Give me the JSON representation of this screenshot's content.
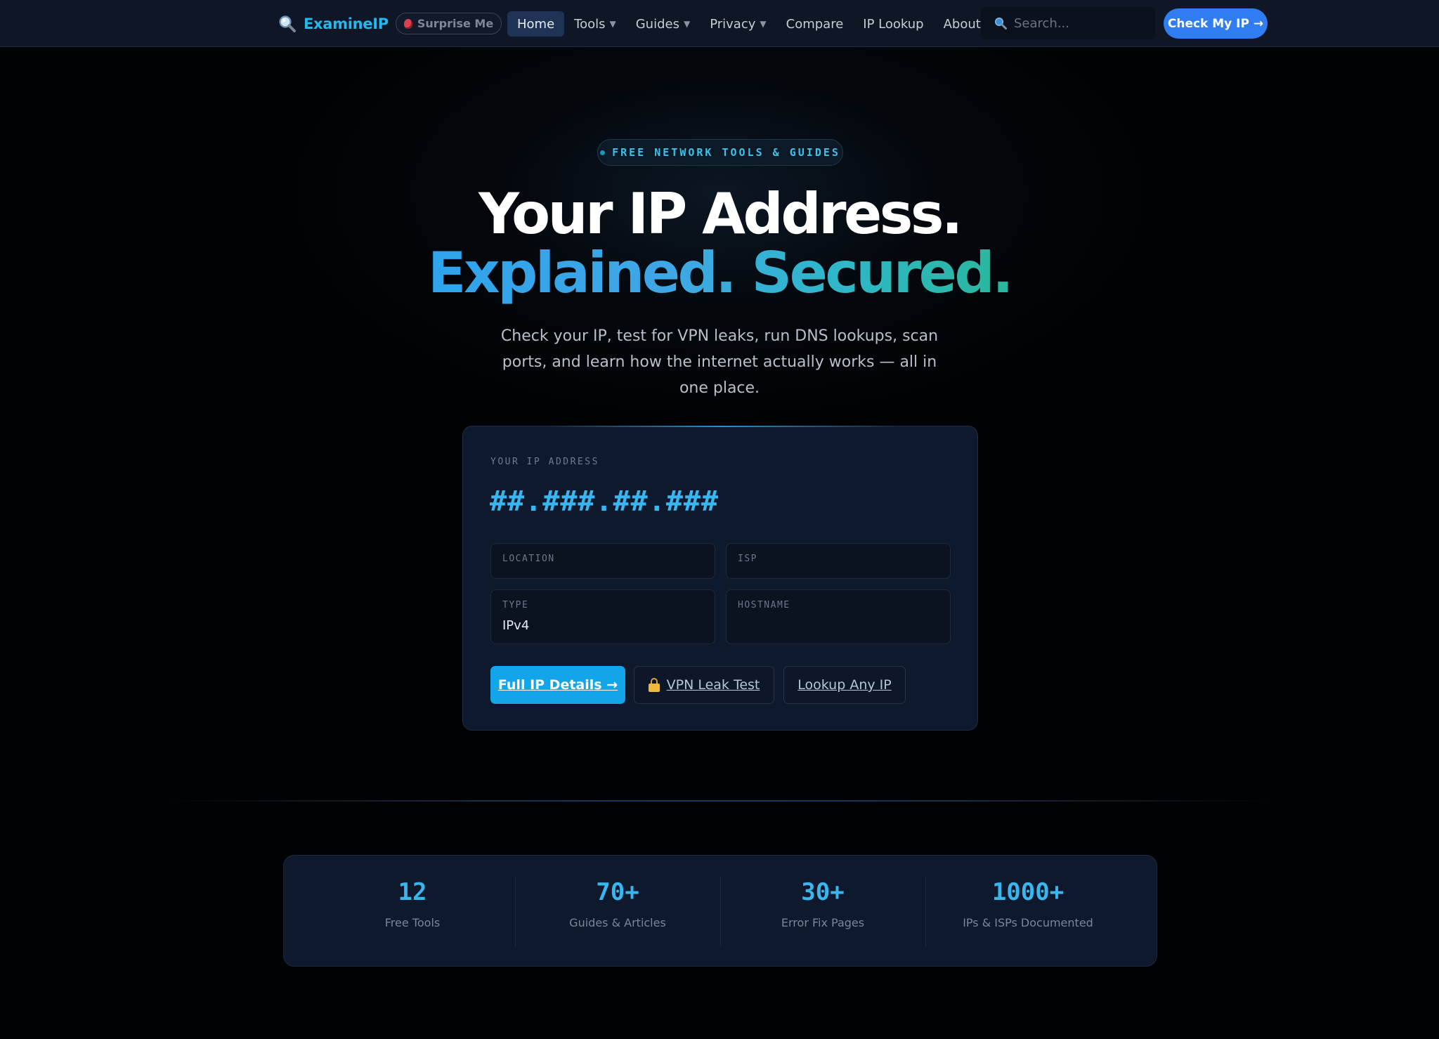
{
  "nav": {
    "logo_text": "ExamineIP",
    "surprise_label": "Surprise Me",
    "links": [
      {
        "label": "Home",
        "active": true,
        "dropdown": false
      },
      {
        "label": "Tools",
        "active": false,
        "dropdown": true
      },
      {
        "label": "Guides",
        "active": false,
        "dropdown": true
      },
      {
        "label": "Privacy",
        "active": false,
        "dropdown": true
      },
      {
        "label": "Compare",
        "active": false,
        "dropdown": false
      },
      {
        "label": "IP Lookup",
        "active": false,
        "dropdown": false
      },
      {
        "label": "About",
        "active": false,
        "dropdown": false
      }
    ],
    "caret": "▼",
    "search_placeholder": "Search...",
    "search_value": "",
    "cta_label": "Check My IP →"
  },
  "hero": {
    "badge": "FREE NETWORK TOOLS & GUIDES",
    "title_line1": "Your IP Address.",
    "title_line2": "Explained. Secured.",
    "subtitle": "Check your IP, test for VPN leaks, run DNS lookups, scan ports, and learn how the internet actually works — all in one place."
  },
  "ip_card": {
    "label": "YOUR IP ADDRESS",
    "ip": "##.###.##.###",
    "fields": {
      "location": {
        "label": "LOCATION",
        "value": ""
      },
      "isp": {
        "label": "ISP",
        "value": ""
      },
      "type": {
        "label": "TYPE",
        "value": "IPv4"
      },
      "hostname": {
        "label": "HOSTNAME",
        "value": ""
      }
    },
    "buttons": {
      "full_details": "Full IP Details →",
      "vpn_leak": "VPN Leak Test",
      "lookup_any": "Lookup Any IP"
    }
  },
  "stats": [
    {
      "value": "12",
      "label": "Free Tools"
    },
    {
      "value": "70+",
      "label": "Guides & Articles"
    },
    {
      "value": "30+",
      "label": "Error Fix Pages"
    },
    {
      "value": "1000+",
      "label": "IPs & ISPs Documented"
    }
  ],
  "colors": {
    "accent": "#2f7df0",
    "cyan": "#38b6f0",
    "background": "#010204",
    "card": "#0f192d"
  }
}
